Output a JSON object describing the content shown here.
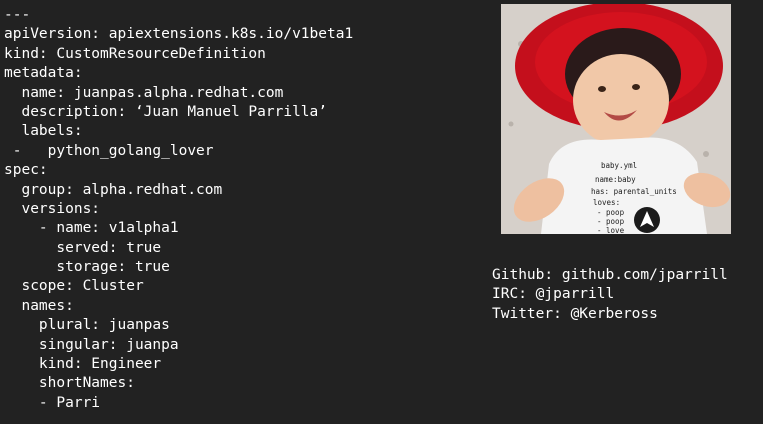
{
  "yaml": {
    "lines": [
      "---",
      "apiVersion: apiextensions.k8s.io/v1beta1",
      "kind: CustomResourceDefinition",
      "metadata:",
      "  name: juanpas.alpha.redhat.com",
      "  description: ‘Juan Manuel Parrilla’",
      "  labels:",
      " -   python_golang_lover",
      "spec:",
      "  group: alpha.redhat.com",
      "  versions:",
      "    - name: v1alpha1",
      "      served: true",
      "      storage: true",
      "  scope: Cluster",
      "  names:",
      "    plural: juanpas",
      "    singular: juanpa",
      "    kind: Engineer",
      "    shortNames:",
      "    - Parri"
    ]
  },
  "photo": {
    "onesie_text": [
      "baby.yml",
      "name:baby",
      "has: parental_units",
      "loves:",
      "- poop",
      "- poop",
      "- love"
    ]
  },
  "contact": {
    "github": "Github: github.com/jparrill",
    "irc": "IRC: @jparrill",
    "twitter": "Twitter: @Kerbeross"
  },
  "colors": {
    "background": "#222222",
    "text": "#ffffff",
    "hat_red": "#d4121e"
  }
}
